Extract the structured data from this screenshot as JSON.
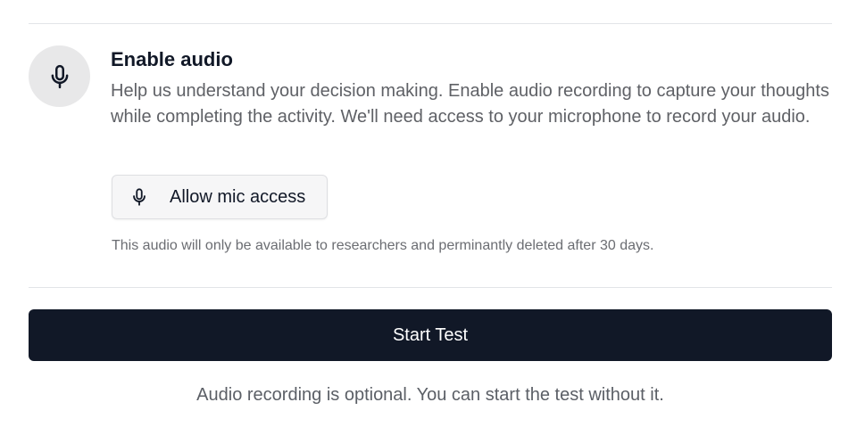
{
  "audio_section": {
    "icon": "microphone-icon",
    "title": "Enable audio",
    "description": "Help us understand your decision making. Enable audio recording to capture your thoughts while completing the activity. We'll need access to your microphone to record your audio.",
    "mic_button": {
      "icon": "microphone-icon",
      "label": "Allow mic access"
    },
    "privacy_note": "This audio will only be available to researchers and perminantly deleted after 30 days."
  },
  "start_button": {
    "label": "Start Test"
  },
  "footnote": "Audio recording is optional. You can start the test without it.",
  "colors": {
    "primary_button_bg": "#111827",
    "primary_button_text": "#ffffff",
    "icon_circle_bg": "#e8e8e9",
    "secondary_button_bg": "#f6f6f7",
    "muted_text": "#5f6166",
    "divider": "#e2e4e8"
  }
}
